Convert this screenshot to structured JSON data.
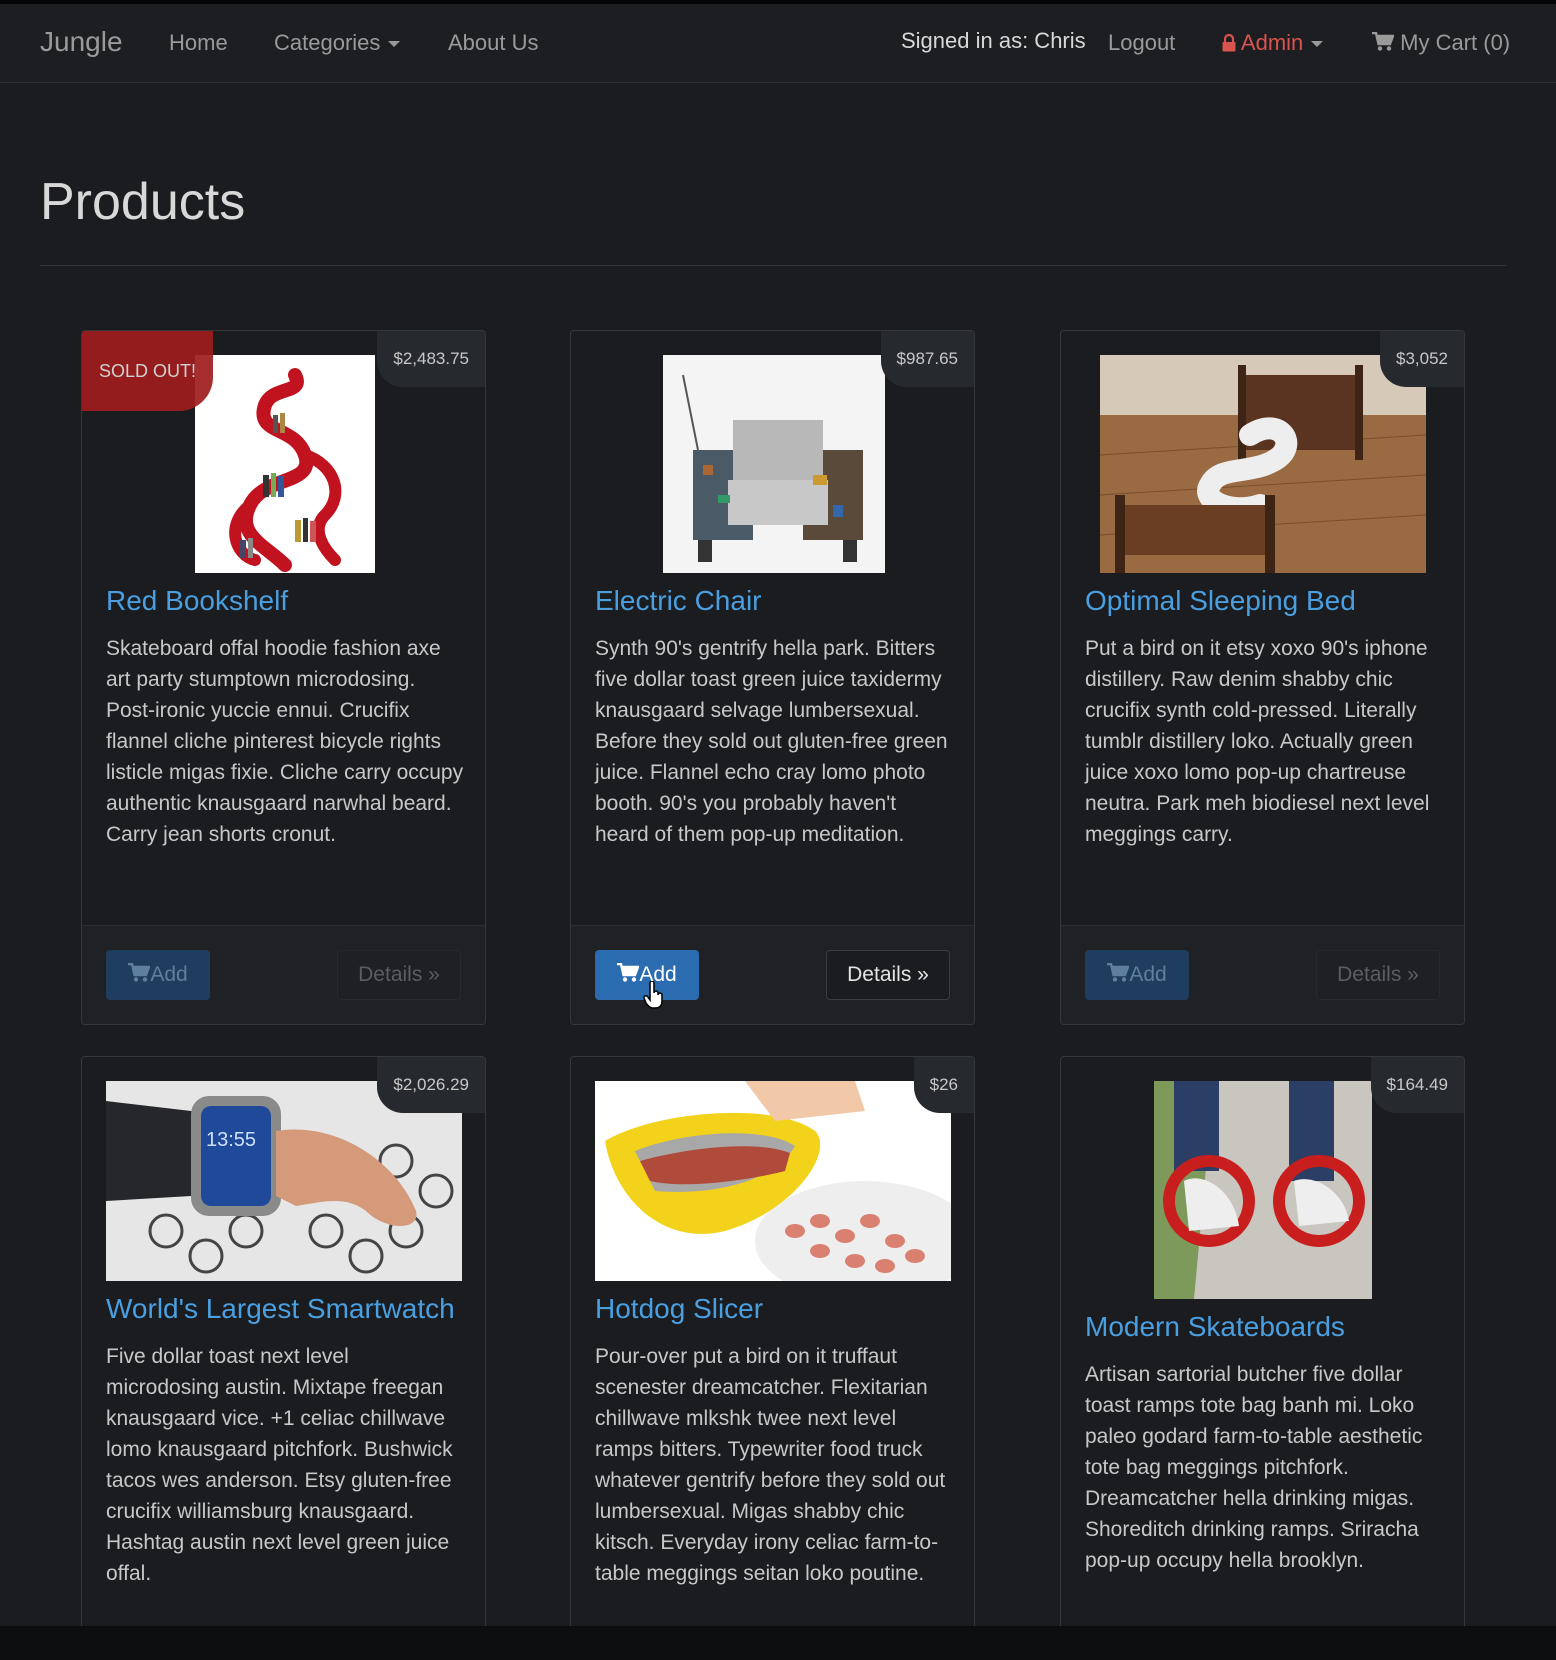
{
  "navbar": {
    "brand": "Jungle",
    "home": "Home",
    "categories": "Categories",
    "about": "About Us",
    "signed_in": "Signed in as: Chris",
    "logout": "Logout",
    "admin": "Admin",
    "cart": "My Cart (0)"
  },
  "colors": {
    "background": "#1a1c1f",
    "link": "#4a9fe0",
    "admin": "#d9534f",
    "sold_out": "#a01d1d",
    "primary_button": "#2b6cb0"
  },
  "page": {
    "title": "Products"
  },
  "products": [
    {
      "name": "Red Bookshelf",
      "price": "$2,483.75",
      "badge": "SOLD OUT!",
      "description": "Skateboard offal hoodie fashion axe art party stumptown microdosing. Post-ironic yuccie ennui. Crucifix flannel cliche pinterest bicycle rights listicle migas fixie. Cliche carry occupy authentic knausgaard narwhal beard. Carry jean shorts cronut.",
      "add_label": "Add",
      "details_label": "Details »",
      "state": "disabled"
    },
    {
      "name": "Electric Chair",
      "price": "$987.65",
      "description": "Synth 90's gentrify hella park. Bitters five dollar toast green juice taxidermy knausgaard selvage lumbersexual. Before they sold out gluten-free green juice. Flannel echo cray lomo photo booth. 90's you probably haven't heard of them pop-up meditation.",
      "add_label": "Add",
      "details_label": "Details »",
      "state": "active"
    },
    {
      "name": "Optimal Sleeping Bed",
      "price": "$3,052",
      "description": "Put a bird on it etsy xoxo 90's iphone distillery. Raw denim shabby chic crucifix synth cold-pressed. Literally tumblr distillery loko. Actually green juice xoxo lomo pop-up chartreuse neutra. Park meh biodiesel next level meggings carry.",
      "add_label": "Add",
      "details_label": "Details »",
      "state": "disabled"
    },
    {
      "name": "World's Largest Smartwatch",
      "price": "$2,026.29",
      "description": "Five dollar toast next level microdosing austin. Mixtape freegan knausgaard vice. +1 celiac chillwave lomo knausgaard pitchfork. Bushwick tacos wes anderson. Etsy gluten-free crucifix williamsburg knausgaard. Hashtag austin next level green juice offal."
    },
    {
      "name": "Hotdog Slicer",
      "price": "$26",
      "description": "Pour-over put a bird on it truffaut scenester dreamcatcher. Flexitarian chillwave mlkshk twee next level ramps bitters. Typewriter food truck whatever gentrify before they sold out lumbersexual. Migas shabby chic kitsch. Everyday irony celiac farm-to-table meggings seitan loko poutine."
    },
    {
      "name": "Modern Skateboards",
      "price": "$164.49",
      "description": "Artisan sartorial butcher five dollar toast ramps tote bag banh mi. Loko paleo godard farm-to-table aesthetic tote bag meggings pitchfork. Dreamcatcher hella drinking migas. Shoreditch drinking ramps. Sriracha pop-up occupy hella brooklyn."
    }
  ]
}
